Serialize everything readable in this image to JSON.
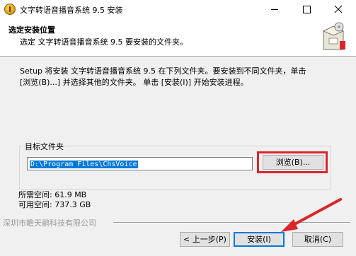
{
  "window": {
    "title": "文字转语音播音系统 9.5 安装",
    "controls": {
      "minimize": "—",
      "maximize": "☐",
      "close": "✕"
    }
  },
  "header": {
    "title": "选定安装位置",
    "subtitle": "选定 文字转语音播音系统 9.5 要安装的文件夹。"
  },
  "body": {
    "description": "Setup 将安装 文字转语音播音系统 9.5 在下列文件夹。要安装到不同文件夹，单击\n[浏览(B)...] 并选择其他的文件夹。 单击 [安装(I)] 开始安装进程。",
    "group_label": "目标文件夹",
    "install_path": "D:\\Program Files\\ChsVoice",
    "browse_label": "浏览(B)...",
    "space_required": "所需空间: 61.9 MB",
    "space_available": "可用空间: 737.3 GB"
  },
  "footer": {
    "company": "深圳市瞻天鹂科技有限公司",
    "back_label": "< 上一步(P)",
    "install_label": "安装(I)",
    "cancel_label": "取消(C)"
  },
  "colors": {
    "highlight_red": "#d9262b",
    "selection_blue": "#0078d7",
    "dialog_bg": "#f0f0f0"
  }
}
